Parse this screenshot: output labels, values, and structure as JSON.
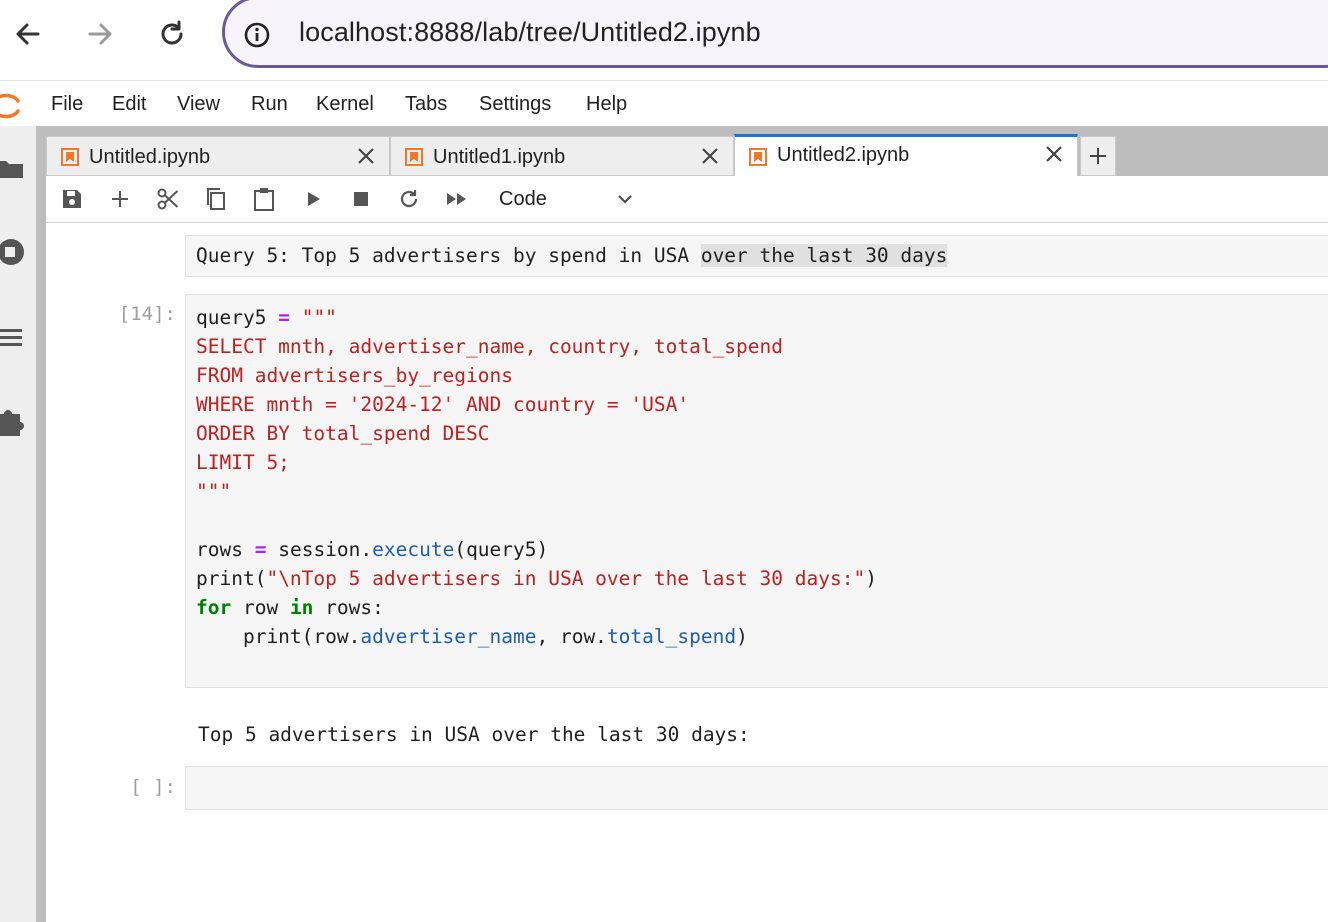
{
  "browser": {
    "url": "localhost:8888/lab/tree/Untitled2.ipynb",
    "icons": [
      "back-arrow-icon",
      "forward-arrow-icon",
      "reload-icon",
      "info-icon"
    ]
  },
  "menu": {
    "items": [
      "File",
      "Edit",
      "View",
      "Run",
      "Kernel",
      "Tabs",
      "Settings",
      "Help"
    ]
  },
  "sidebar": {
    "icons": [
      "folder-icon",
      "running-icon",
      "table-of-contents-icon",
      "extension-icon"
    ]
  },
  "tabs": [
    {
      "label": "Untitled.ipynb",
      "active": false
    },
    {
      "label": "Untitled1.ipynb",
      "active": false
    },
    {
      "label": "Untitled2.ipynb",
      "active": true
    }
  ],
  "toolbar": {
    "cell_type": "Code",
    "buttons": [
      "save-icon",
      "add-cell-icon",
      "cut-icon",
      "copy-icon",
      "paste-icon",
      "run-icon",
      "stop-icon",
      "restart-icon",
      "fast-forward-icon"
    ]
  },
  "notebook": {
    "markdown_cell": {
      "text": "Query 5: Top 5 advertisers by spend in USA ",
      "highlight": "over the last 30 days"
    },
    "code_cell": {
      "prompt": "[14]:",
      "lines": {
        "l1_var": "query5",
        "l1_op": "=",
        "l1_str": "\"\"\"",
        "l2": "SELECT mnth, advertiser_name, country, total_spend",
        "l3": "FROM advertisers_by_regions",
        "l4": "WHERE mnth = '2024-12' AND country = 'USA'",
        "l5": "ORDER BY total_spend DESC",
        "l6": "LIMIT 5;",
        "l7": "\"\"\"",
        "l9_var": "rows",
        "l9_op": "=",
        "l9_obj": "session.",
        "l9_fn": "execute",
        "l9_args": "(query5)",
        "l10_fn": "print(",
        "l10_str": "\"\\nTop 5 advertisers in USA over the last 30 days:\"",
        "l10_end": ")",
        "l11_for": "for",
        "l11_mid": " row ",
        "l11_in": "in",
        "l11_end": " rows:",
        "l12_a": "    print(row.",
        "l12_attr1": "advertiser_name",
        "l12_b": ", row.",
        "l12_attr2": "total_spend",
        "l12_c": ")"
      }
    },
    "output": "Top 5 advertisers in USA over the last 30 days:",
    "empty_prompt": "[ ]:"
  },
  "colors": {
    "url_border": "#6a5a9c",
    "active_tab_accent": "#1976d2",
    "jupyter_orange": "#f37726",
    "keyword": "#008000",
    "string": "#ba2121",
    "operator": "#aa22ff",
    "attribute": "#1d5ea6"
  }
}
